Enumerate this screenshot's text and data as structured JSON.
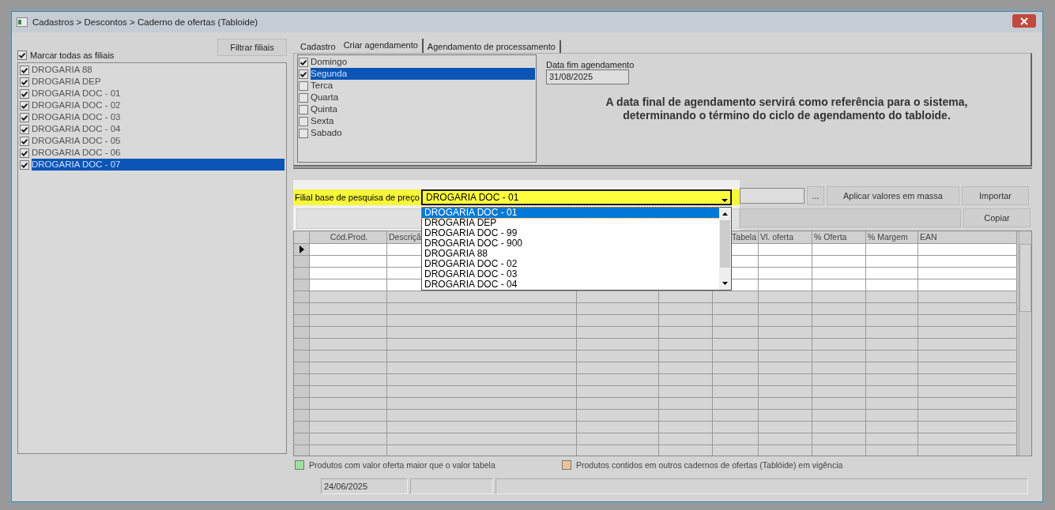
{
  "window": {
    "title": "Cadastros > Descontos > Caderno de ofertas (Tabloide)"
  },
  "branches": {
    "filter_button": "Filtrar filiais",
    "select_all": {
      "label": "Marcar todas as filiais",
      "checked": true
    },
    "items": [
      {
        "label": "DROGARIA 88",
        "checked": true,
        "selected": false
      },
      {
        "label": "DROGARIA DEP",
        "checked": true,
        "selected": false
      },
      {
        "label": "DROGARIA DOC - 01",
        "checked": true,
        "selected": false
      },
      {
        "label": "DROGARIA DOC - 02",
        "checked": true,
        "selected": false
      },
      {
        "label": "DROGARIA DOC - 03",
        "checked": true,
        "selected": false
      },
      {
        "label": "DROGARIA DOC - 04",
        "checked": true,
        "selected": false
      },
      {
        "label": "DROGARIA DOC - 05",
        "checked": true,
        "selected": false
      },
      {
        "label": "DROGARIA DOC - 06",
        "checked": true,
        "selected": false
      },
      {
        "label": "DROGARIA DOC - 07",
        "checked": true,
        "selected": true
      }
    ]
  },
  "tabs": [
    {
      "label": "Cadastro",
      "selected": false
    },
    {
      "label": "Criar agendamento",
      "selected": true
    },
    {
      "label": "Agendamento de processamento",
      "selected": false
    }
  ],
  "weekdays": [
    {
      "label": "Domingo",
      "checked": true,
      "selected": false
    },
    {
      "label": "Segunda",
      "checked": true,
      "selected": true
    },
    {
      "label": "Terca",
      "checked": false,
      "selected": false
    },
    {
      "label": "Quarta",
      "checked": false,
      "selected": false
    },
    {
      "label": "Quinta",
      "checked": false,
      "selected": false
    },
    {
      "label": "Sexta",
      "checked": false,
      "selected": false
    },
    {
      "label": "Sabado",
      "checked": false,
      "selected": false
    }
  ],
  "end_date": {
    "label": "Data fim agendamento",
    "value": "31/08/2025"
  },
  "info_message": "A data final de agendamento servirá como referência para o sistema,\ndeterminando o término do ciclo de agendamento do tabloide.",
  "price_branch": {
    "label": "Filial base de pesquisa de preço",
    "value": "DROGARIA DOC - 01",
    "expanded": true,
    "options": [
      {
        "label": "DROGARIA DOC - 01",
        "selected": true
      },
      {
        "label": "DROGARIA DEP",
        "selected": false
      },
      {
        "label": "DROGARIA DOC - 99",
        "selected": false
      },
      {
        "label": "DROGARIA DOC - 900",
        "selected": false
      },
      {
        "label": "DROGARIA 88",
        "selected": false
      },
      {
        "label": "DROGARIA DOC - 02",
        "selected": false
      },
      {
        "label": "DROGARIA DOC - 03",
        "selected": false
      },
      {
        "label": "DROGARIA DOC - 04",
        "selected": false
      }
    ]
  },
  "toolbar": {
    "browse_button": "...",
    "apply_button": "Aplicar valores em massa",
    "import_button": "Importar",
    "copy_button": "Copiar"
  },
  "grid": {
    "columns": [
      {
        "label": "Cód.Prod."
      },
      {
        "label": "Descriçã"
      },
      {},
      {},
      {
        "label": "Tabela"
      },
      {
        "label": "Vl. oferta"
      },
      {
        "label": "% Oferta"
      },
      {
        "label": "% Margem"
      },
      {
        "label": "EAN"
      }
    ],
    "rows": [
      {
        "current": true
      },
      {
        "current": false
      },
      {
        "current": false
      },
      {
        "current": false
      },
      {
        "current": false
      },
      {
        "current": false
      },
      {
        "current": false
      },
      {
        "current": false
      },
      {
        "current": false
      },
      {
        "current": false
      },
      {
        "current": false
      },
      {
        "current": false
      },
      {
        "current": false
      },
      {
        "current": false
      },
      {
        "current": false
      },
      {
        "current": false
      },
      {
        "current": false
      },
      {
        "current": false
      }
    ]
  },
  "legend": [
    {
      "label": "Produtos com valor oferta maior que o valor tabela",
      "color": "#9ee09e"
    },
    {
      "label": "Produtos contidos em outros cadernos de ofertas (Tablóide) em vigência",
      "color": "#e8c49a"
    }
  ],
  "status_bar": [
    "24/06/2025"
  ]
}
